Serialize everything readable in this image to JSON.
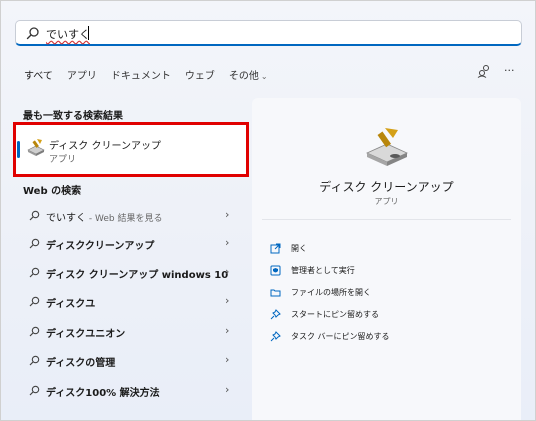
{
  "search": {
    "value": "でいすく"
  },
  "tabs": [
    {
      "label": "すべて"
    },
    {
      "label": "アプリ"
    },
    {
      "label": "ドキュメント"
    },
    {
      "label": "ウェブ"
    },
    {
      "label": "その他"
    }
  ],
  "more_label": "···",
  "best_match": {
    "heading": "最も一致する検索結果",
    "name": "ディスク クリーンアップ",
    "type": "アプリ"
  },
  "web": {
    "heading": "Web の検索",
    "first": {
      "text": "でいすく",
      "hint": " - Web 結果を見る"
    },
    "items": [
      "ディスククリーンアップ",
      "ディスク クリーンアップ windows 10",
      "ディスクユ",
      "ディスクユニオン",
      "ディスクの管理",
      "ディスク100% 解決方法"
    ]
  },
  "details": {
    "title": "ディスク クリーンアップ",
    "type": "アプリ",
    "actions": [
      {
        "label": "開く",
        "icon": "open-icon"
      },
      {
        "label": "管理者として実行",
        "icon": "admin-shield-icon"
      },
      {
        "label": "ファイルの場所を開く",
        "icon": "folder-icon"
      },
      {
        "label": "スタートにピン留めする",
        "icon": "pin-icon"
      },
      {
        "label": "タスク バーにピン留めする",
        "icon": "pin-icon"
      }
    ]
  },
  "colors": {
    "accent": "#0067c0",
    "highlight_border": "#e00000"
  }
}
